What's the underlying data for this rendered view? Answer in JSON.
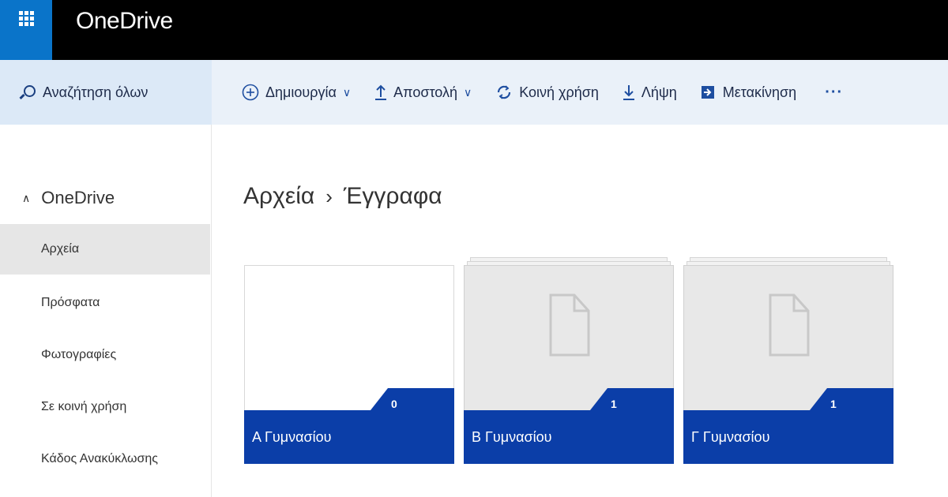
{
  "app": {
    "brand": "OneDrive"
  },
  "search": {
    "label": "Αναζήτηση όλων"
  },
  "toolbar": {
    "create": "Δημιουργία",
    "upload": "Αποστολή",
    "share": "Κοινή χρήση",
    "download": "Λήψη",
    "move": "Μετακίνηση",
    "more": "···",
    "chevron": "∨"
  },
  "sidebar": {
    "root": "OneDrive",
    "caret": "∧",
    "items": [
      {
        "label": "Αρχεία",
        "active": true
      },
      {
        "label": "Πρόσφατα"
      },
      {
        "label": "Φωτογραφίες"
      },
      {
        "label": "Σε κοινή χρήση"
      },
      {
        "label": "Κάδος Ανακύκλωσης"
      }
    ]
  },
  "breadcrumb": {
    "parent": "Αρχεία",
    "separator": "›",
    "current": "Έγγραφα"
  },
  "folders": [
    {
      "name": "Α Γυμνασίου",
      "count": "0"
    },
    {
      "name": "Β Γυμνασίου",
      "count": "1"
    },
    {
      "name": "Γ Γυμνασίου",
      "count": "1"
    }
  ],
  "colors": {
    "topbar": "#000000",
    "waffle": "#0a74c9",
    "accent": "#0b3ea8",
    "cmdbar": "#eaf1f9",
    "search": "#dce9f7"
  },
  "icons": [
    "waffle-icon",
    "search-icon",
    "plus-circle-icon",
    "upload-icon",
    "share-icon",
    "download-icon",
    "move-icon",
    "more-icon",
    "document-icon"
  ]
}
